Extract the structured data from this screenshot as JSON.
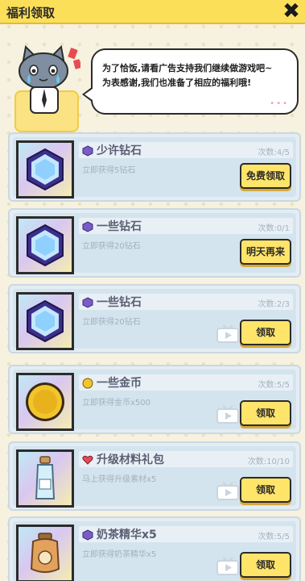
{
  "header": {
    "title": "福利领取",
    "close_glyph": "✖"
  },
  "banner": {
    "line1": "为了恰饭,请看广告支持我们继续做游戏吧~",
    "line2": "为表感谢,我们也准备了相应的福利哦!",
    "dots": "•••"
  },
  "cards": [
    {
      "title": "少许钻石",
      "count": "次数:4/5",
      "desc": "立即获得5钻石",
      "button": "免费领取",
      "icon": "purple-gem-icon",
      "thumb": "diamond",
      "video": false
    },
    {
      "title": "一些钻石",
      "count": "次数:0/1",
      "desc": "立即获得20钻石",
      "button": "明天再来",
      "icon": "purple-gem-icon",
      "thumb": "diamond",
      "video": false
    },
    {
      "title": "一些钻石",
      "count": "次数:2/3",
      "desc": "立即获得20钻石",
      "button": "领取",
      "icon": "purple-gem-icon",
      "thumb": "diamond",
      "video": true
    },
    {
      "title": "一些金币",
      "count": "次数:5/5",
      "desc": "立即获得金币x500",
      "button": "领取",
      "icon": "gold-coin-icon",
      "thumb": "coin",
      "video": true
    },
    {
      "title": "升级材料礼包",
      "count": "次数:10/10",
      "desc": "马上获得升级素材x5",
      "button": "领取",
      "icon": "heart-icon",
      "thumb": "bottle",
      "video": true
    },
    {
      "title": "奶茶精华x5",
      "count": "次数:5/5",
      "desc": "立即获得奶茶精华x5",
      "button": "领取",
      "icon": "purple-gem-icon",
      "thumb": "jar",
      "video": true
    }
  ],
  "colors": {
    "header": "#fbdf58",
    "button": "#ffe46a",
    "card": "#e4edf3",
    "gem": "#7a5cc8",
    "coin": "#f2c52c",
    "heart": "#e24b57"
  }
}
